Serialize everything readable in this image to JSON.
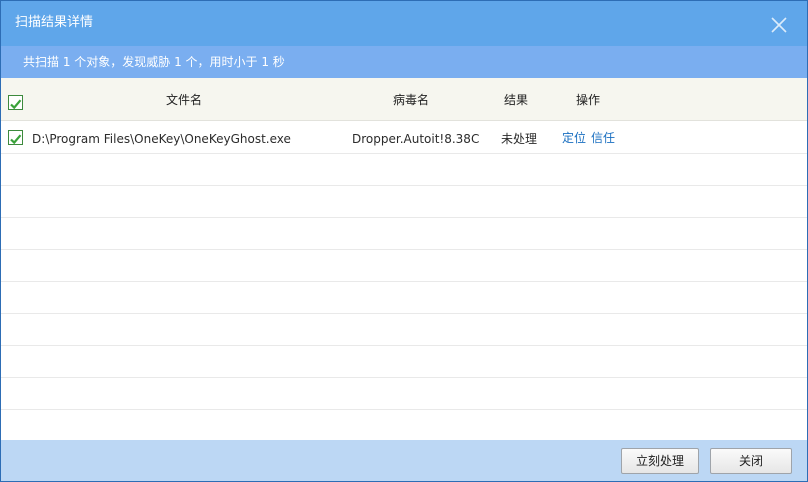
{
  "window": {
    "title": "扫描结果详情",
    "close_icon": "close-icon"
  },
  "summary": {
    "text": "共扫描 1 个对象，发现威胁 1 个，用时小于 1 秒"
  },
  "table": {
    "select_all_checked": true,
    "columns": [
      "文件名",
      "病毒名",
      "结果",
      "操作"
    ],
    "rows": [
      {
        "checked": true,
        "file": "D:\\Program Files\\OneKey\\OneKeyGhost.exe",
        "virus": "Dropper.Autoit!8.38C",
        "result": "未处理",
        "actions": [
          "定位",
          "信任"
        ]
      }
    ]
  },
  "footer": {
    "handle_button": "立刻处理",
    "close_button": "关闭"
  },
  "colors": {
    "titlebar": "#5fa6ea",
    "summary_bar": "#7aaef0",
    "footer": "#bcd7f4",
    "link": "#1a6fc0",
    "check": "#3aa23a"
  }
}
